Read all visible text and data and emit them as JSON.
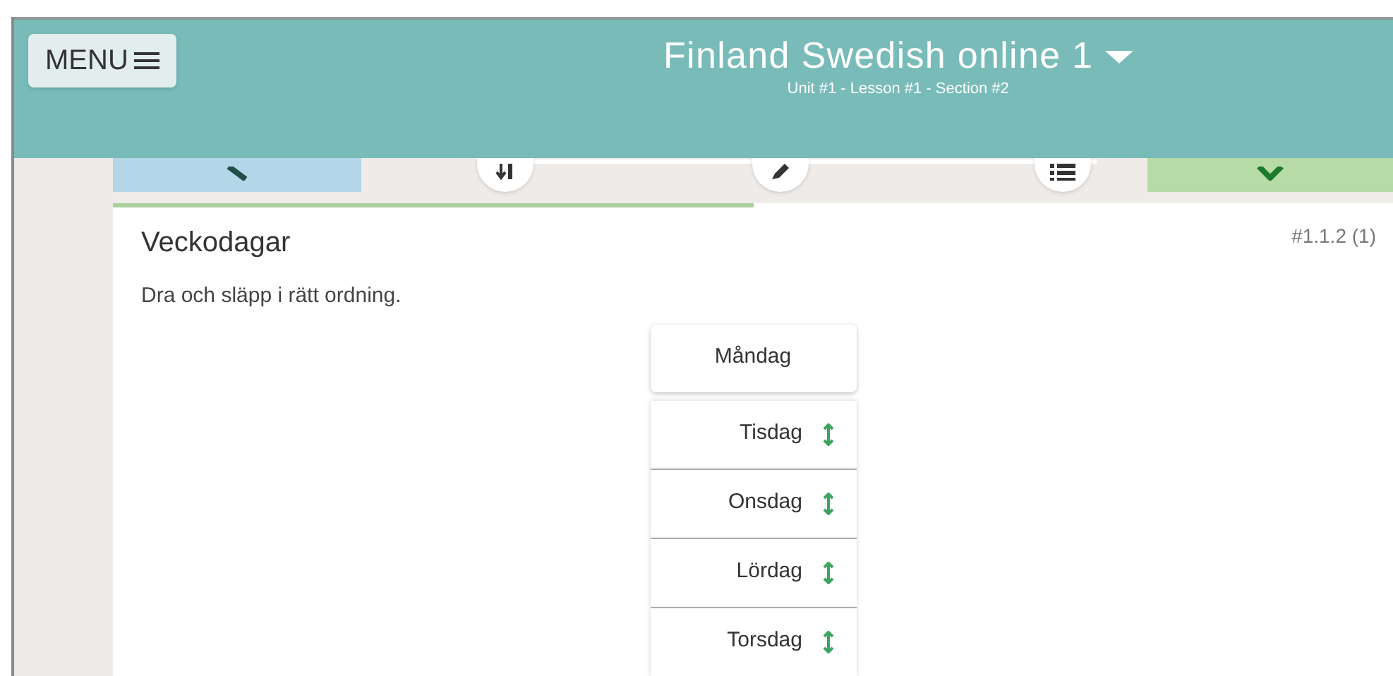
{
  "menu_button": {
    "label": "MENU"
  },
  "header": {
    "title": "Finland Swedish online 1",
    "subtitle": "Unit #1 - Lesson #1 - Section #2"
  },
  "steps": [
    {
      "kind": "intro"
    },
    {
      "kind": "sort"
    },
    {
      "kind": "write"
    },
    {
      "kind": "list"
    },
    {
      "kind": "done"
    }
  ],
  "progress": {
    "level": 0.5
  },
  "exercise": {
    "title": "Veckodagar",
    "id": "#1.1.2 (1)",
    "instruction": "Dra och släpp i rätt ordning."
  },
  "items": [
    {
      "label": "Måndag",
      "kind": "fixed"
    },
    {
      "label": "Tisdag",
      "kind": "draggable"
    },
    {
      "label": "Onsdag",
      "kind": "draggable"
    },
    {
      "label": "Lördag",
      "kind": "draggable"
    },
    {
      "label": "Torsdag",
      "kind": "draggable"
    }
  ]
}
